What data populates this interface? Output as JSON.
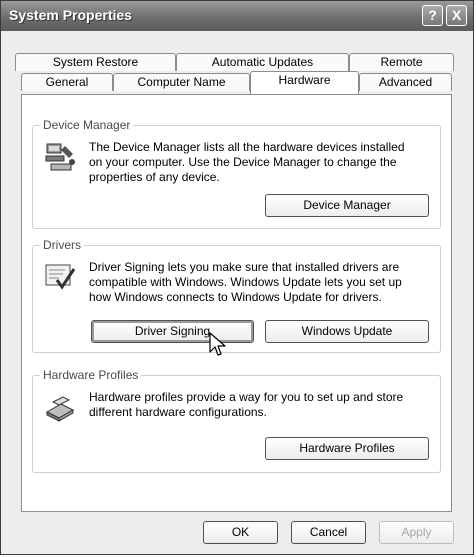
{
  "window": {
    "title": "System Properties",
    "help_glyph": "?",
    "close_glyph": "X"
  },
  "tabs_back": [
    "System Restore",
    "Automatic Updates",
    "Remote"
  ],
  "tabs_front": [
    "General",
    "Computer Name",
    "Hardware",
    "Advanced"
  ],
  "active_tab": "Hardware",
  "device_manager": {
    "legend": "Device Manager",
    "line1": "The Device Manager lists all the hardware devices installed",
    "line2": "on your computer. Use the Device Manager to change the",
    "line3": "properties of any device.",
    "button": "Device Manager",
    "icon": "device-manager-icon"
  },
  "drivers": {
    "legend": "Drivers",
    "line1": "Driver Signing lets you make sure that installed drivers are",
    "line2": "compatible with Windows. Windows Update lets you set up",
    "line3": "how Windows connects to Windows Update for drivers.",
    "signing_button": "Driver Signing",
    "update_button": "Windows Update",
    "icon": "driver-signing-icon"
  },
  "hardware_profiles": {
    "legend": "Hardware Profiles",
    "line1": "Hardware profiles provide a way for you to set up and store",
    "line2": "different hardware configurations.",
    "button": "Hardware Profiles",
    "icon": "hardware-profiles-icon"
  },
  "footer": {
    "ok": "OK",
    "cancel": "Cancel",
    "apply": "Apply"
  }
}
